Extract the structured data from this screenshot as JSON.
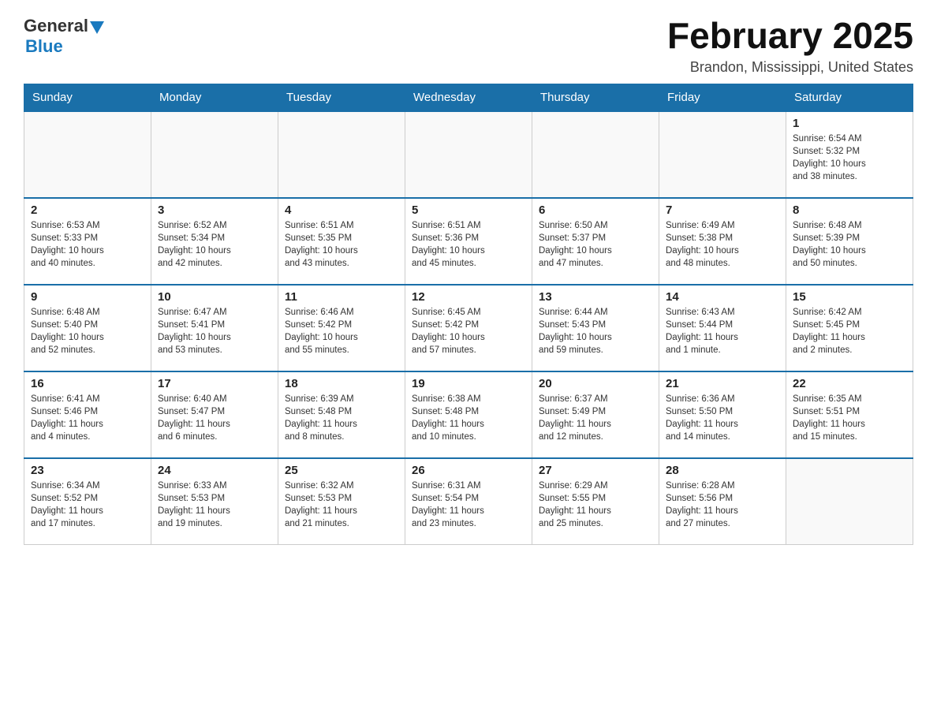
{
  "header": {
    "logo_general": "General",
    "logo_blue": "Blue",
    "month_title": "February 2025",
    "location": "Brandon, Mississippi, United States"
  },
  "weekdays": [
    "Sunday",
    "Monday",
    "Tuesday",
    "Wednesday",
    "Thursday",
    "Friday",
    "Saturday"
  ],
  "weeks": [
    {
      "days": [
        {
          "number": "",
          "info": ""
        },
        {
          "number": "",
          "info": ""
        },
        {
          "number": "",
          "info": ""
        },
        {
          "number": "",
          "info": ""
        },
        {
          "number": "",
          "info": ""
        },
        {
          "number": "",
          "info": ""
        },
        {
          "number": "1",
          "info": "Sunrise: 6:54 AM\nSunset: 5:32 PM\nDaylight: 10 hours\nand 38 minutes."
        }
      ]
    },
    {
      "days": [
        {
          "number": "2",
          "info": "Sunrise: 6:53 AM\nSunset: 5:33 PM\nDaylight: 10 hours\nand 40 minutes."
        },
        {
          "number": "3",
          "info": "Sunrise: 6:52 AM\nSunset: 5:34 PM\nDaylight: 10 hours\nand 42 minutes."
        },
        {
          "number": "4",
          "info": "Sunrise: 6:51 AM\nSunset: 5:35 PM\nDaylight: 10 hours\nand 43 minutes."
        },
        {
          "number": "5",
          "info": "Sunrise: 6:51 AM\nSunset: 5:36 PM\nDaylight: 10 hours\nand 45 minutes."
        },
        {
          "number": "6",
          "info": "Sunrise: 6:50 AM\nSunset: 5:37 PM\nDaylight: 10 hours\nand 47 minutes."
        },
        {
          "number": "7",
          "info": "Sunrise: 6:49 AM\nSunset: 5:38 PM\nDaylight: 10 hours\nand 48 minutes."
        },
        {
          "number": "8",
          "info": "Sunrise: 6:48 AM\nSunset: 5:39 PM\nDaylight: 10 hours\nand 50 minutes."
        }
      ]
    },
    {
      "days": [
        {
          "number": "9",
          "info": "Sunrise: 6:48 AM\nSunset: 5:40 PM\nDaylight: 10 hours\nand 52 minutes."
        },
        {
          "number": "10",
          "info": "Sunrise: 6:47 AM\nSunset: 5:41 PM\nDaylight: 10 hours\nand 53 minutes."
        },
        {
          "number": "11",
          "info": "Sunrise: 6:46 AM\nSunset: 5:42 PM\nDaylight: 10 hours\nand 55 minutes."
        },
        {
          "number": "12",
          "info": "Sunrise: 6:45 AM\nSunset: 5:42 PM\nDaylight: 10 hours\nand 57 minutes."
        },
        {
          "number": "13",
          "info": "Sunrise: 6:44 AM\nSunset: 5:43 PM\nDaylight: 10 hours\nand 59 minutes."
        },
        {
          "number": "14",
          "info": "Sunrise: 6:43 AM\nSunset: 5:44 PM\nDaylight: 11 hours\nand 1 minute."
        },
        {
          "number": "15",
          "info": "Sunrise: 6:42 AM\nSunset: 5:45 PM\nDaylight: 11 hours\nand 2 minutes."
        }
      ]
    },
    {
      "days": [
        {
          "number": "16",
          "info": "Sunrise: 6:41 AM\nSunset: 5:46 PM\nDaylight: 11 hours\nand 4 minutes."
        },
        {
          "number": "17",
          "info": "Sunrise: 6:40 AM\nSunset: 5:47 PM\nDaylight: 11 hours\nand 6 minutes."
        },
        {
          "number": "18",
          "info": "Sunrise: 6:39 AM\nSunset: 5:48 PM\nDaylight: 11 hours\nand 8 minutes."
        },
        {
          "number": "19",
          "info": "Sunrise: 6:38 AM\nSunset: 5:48 PM\nDaylight: 11 hours\nand 10 minutes."
        },
        {
          "number": "20",
          "info": "Sunrise: 6:37 AM\nSunset: 5:49 PM\nDaylight: 11 hours\nand 12 minutes."
        },
        {
          "number": "21",
          "info": "Sunrise: 6:36 AM\nSunset: 5:50 PM\nDaylight: 11 hours\nand 14 minutes."
        },
        {
          "number": "22",
          "info": "Sunrise: 6:35 AM\nSunset: 5:51 PM\nDaylight: 11 hours\nand 15 minutes."
        }
      ]
    },
    {
      "days": [
        {
          "number": "23",
          "info": "Sunrise: 6:34 AM\nSunset: 5:52 PM\nDaylight: 11 hours\nand 17 minutes."
        },
        {
          "number": "24",
          "info": "Sunrise: 6:33 AM\nSunset: 5:53 PM\nDaylight: 11 hours\nand 19 minutes."
        },
        {
          "number": "25",
          "info": "Sunrise: 6:32 AM\nSunset: 5:53 PM\nDaylight: 11 hours\nand 21 minutes."
        },
        {
          "number": "26",
          "info": "Sunrise: 6:31 AM\nSunset: 5:54 PM\nDaylight: 11 hours\nand 23 minutes."
        },
        {
          "number": "27",
          "info": "Sunrise: 6:29 AM\nSunset: 5:55 PM\nDaylight: 11 hours\nand 25 minutes."
        },
        {
          "number": "28",
          "info": "Sunrise: 6:28 AM\nSunset: 5:56 PM\nDaylight: 11 hours\nand 27 minutes."
        },
        {
          "number": "",
          "info": ""
        }
      ]
    }
  ]
}
